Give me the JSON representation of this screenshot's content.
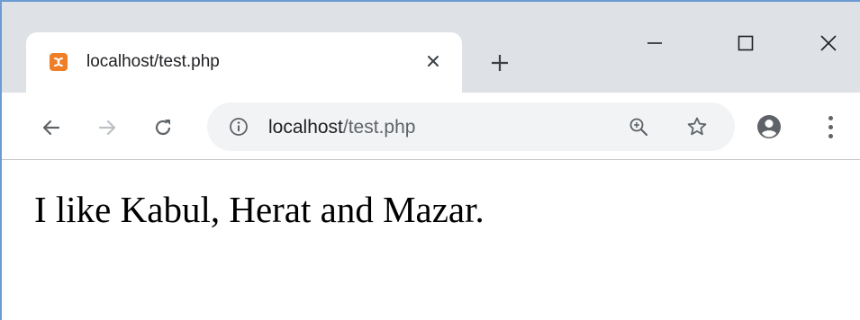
{
  "window": {
    "controls": {
      "minimize_icon": "minimize-icon",
      "maximize_icon": "maximize-icon",
      "close_icon": "close-icon"
    }
  },
  "tab": {
    "title": "localhost/test.php",
    "favicon": "xampp-icon",
    "favicon_color": "#f07e26",
    "close_icon": "close-icon"
  },
  "new_tab_icon": "plus-icon",
  "toolbar": {
    "back_icon": "arrow-left-icon",
    "forward_icon": "arrow-right-icon",
    "reload_icon": "reload-icon",
    "omnibox": {
      "info_icon": "info-icon",
      "url_host": "localhost",
      "url_path": "/test.php",
      "zoom_icon": "zoom-in-icon",
      "bookmark_icon": "star-icon"
    },
    "profile_icon": "account-icon",
    "menu_icon": "more-vertical-icon"
  },
  "page": {
    "text": "I like Kabul, Herat and Mazar."
  },
  "colors": {
    "tabstrip": "#dee1e6",
    "omnibox": "#f1f3f4",
    "icon": "#5f6368",
    "icon_disabled": "#bdc1c6"
  }
}
